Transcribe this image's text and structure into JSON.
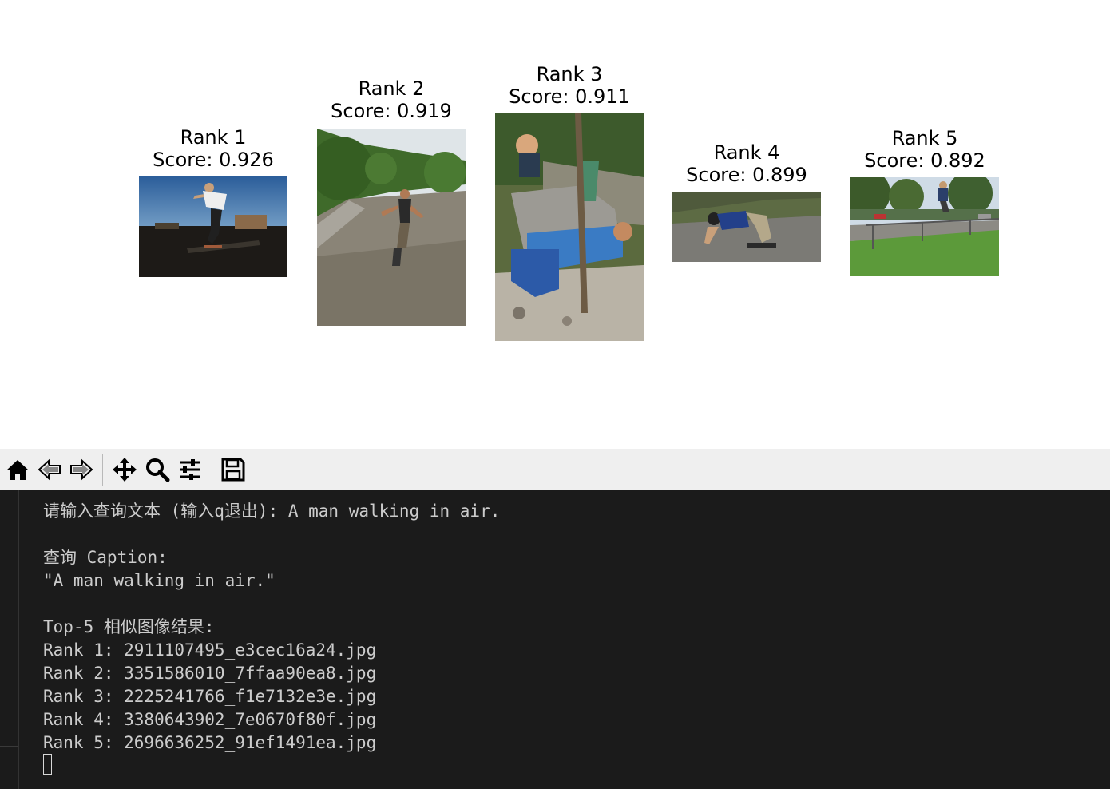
{
  "figure": {
    "panels": [
      {
        "rank_label": "Rank 1",
        "score_label": "Score: 0.926",
        "image_desc": "skateboarder-grinding-rail"
      },
      {
        "rank_label": "Rank 2",
        "score_label": "Score: 0.919",
        "image_desc": "child-rollerblading-skatepark"
      },
      {
        "rank_label": "Rank 3",
        "score_label": "Score: 0.911",
        "image_desc": "man-lying-in-junk-pile"
      },
      {
        "rank_label": "Rank 4",
        "score_label": "Score: 0.899",
        "image_desc": "longboarder-crouching-road"
      },
      {
        "rank_label": "Rank 5",
        "score_label": "Score: 0.892",
        "image_desc": "skater-jumping-over-railing"
      }
    ]
  },
  "toolbar": {
    "buttons": [
      "home-icon",
      "back-arrow-icon",
      "forward-arrow-icon",
      "pan-move-icon",
      "zoom-magnifier-icon",
      "configure-subplots-icon",
      "save-floppy-icon"
    ],
    "icon_color": "#000000",
    "background": "#efefef"
  },
  "terminal": {
    "prompt_line": "请输入查询文本 (输入q退出): A man walking in air.",
    "query_header": "查询 Caption:",
    "query_text": "\"A man walking in air.\"",
    "results_header": "Top-5 相似图像结果:",
    "results": [
      "Rank 1: 2911107495_e3cec16a24.jpg",
      "Rank 2: 3351586010_7ffaa90ea8.jpg",
      "Rank 3: 2225241766_f1e7132e3e.jpg",
      "Rank 4: 3380643902_7e0670f80f.jpg",
      "Rank 5: 2696636252_91ef1491ea.jpg"
    ],
    "background": "#1b1b1b",
    "text_color": "#cccccc"
  }
}
